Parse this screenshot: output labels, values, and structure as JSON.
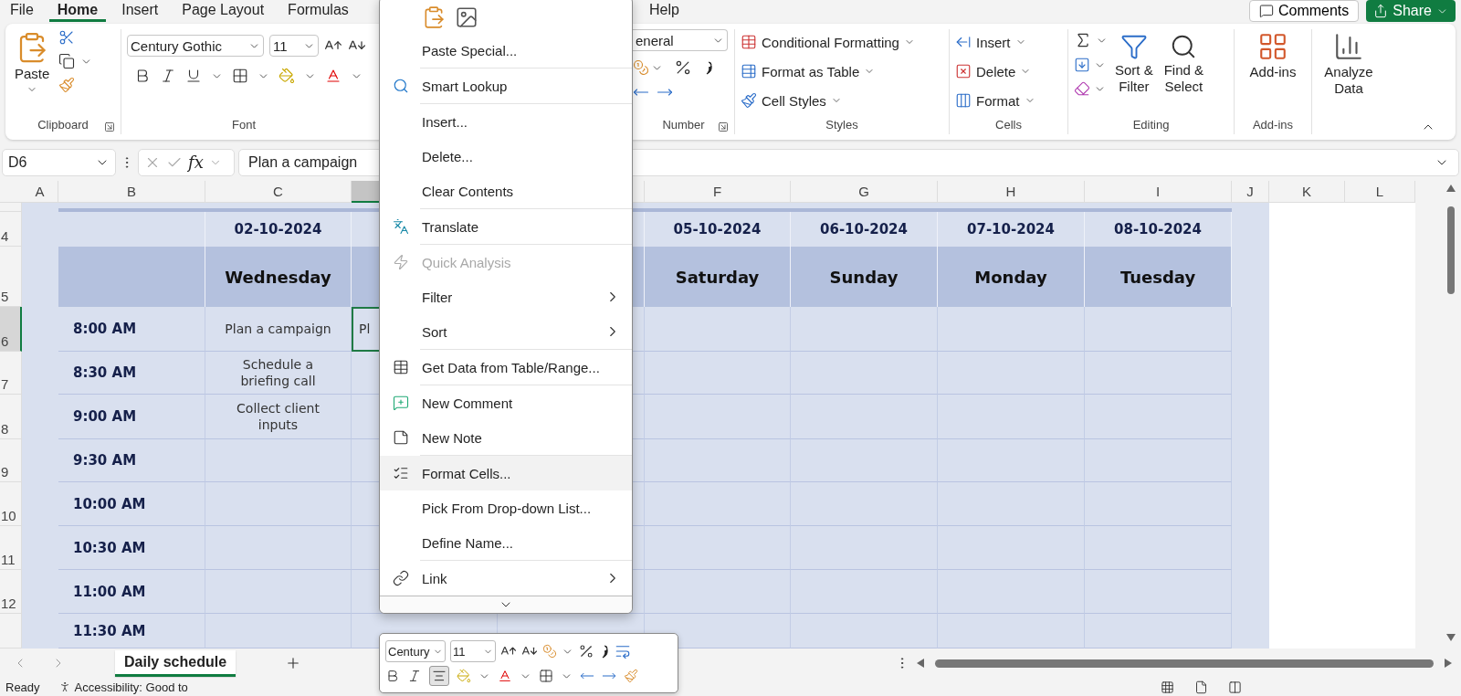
{
  "ribbon_tabs": [
    {
      "label": "File",
      "selected": false
    },
    {
      "label": "Home",
      "selected": true
    },
    {
      "label": "Insert",
      "selected": false
    },
    {
      "label": "Page Layout",
      "selected": false
    },
    {
      "label": "Formulas",
      "selected": false
    },
    {
      "label": "Help",
      "selected": false
    }
  ],
  "top_buttons": {
    "comments": "Comments",
    "share": "Share"
  },
  "ribbon": {
    "clipboard": {
      "paste": "Paste",
      "label": "Clipboard"
    },
    "font": {
      "name": "Century Gothic",
      "size": "11",
      "label": "Font"
    },
    "number": {
      "format": "eneral",
      "label": "Number"
    },
    "styles": {
      "items": [
        "Conditional Formatting",
        "Format as Table",
        "Cell Styles"
      ],
      "label": "Styles"
    },
    "cells": {
      "items": [
        "Insert",
        "Delete",
        "Format"
      ],
      "label": "Cells"
    },
    "editing": {
      "sort_filter": [
        "Sort &",
        "Filter"
      ],
      "find_select": [
        "Find &",
        "Select"
      ],
      "label": "Editing"
    },
    "addins": {
      "button": "Add-ins",
      "label": "Add-ins"
    },
    "analyze": {
      "button": [
        "Analyze",
        "Data"
      ]
    }
  },
  "formula_bar": {
    "name_box": "D6",
    "function_symbol": "fx",
    "formula": "Plan a campaign"
  },
  "sheet": {
    "columns": [
      {
        "label": "A",
        "selected": false
      },
      {
        "label": "B",
        "selected": false
      },
      {
        "label": "C",
        "selected": false
      },
      {
        "selected": true
      },
      {},
      {
        "label": "F",
        "selected": false
      },
      {
        "label": "G",
        "selected": false
      },
      {
        "label": "H",
        "selected": false
      },
      {
        "label": "I",
        "selected": false
      },
      {
        "label": "J",
        "selected": false
      },
      {
        "label": "K",
        "selected": false
      },
      {
        "label": "L",
        "selected": false
      }
    ],
    "rows": [
      {
        "kind": "spacer",
        "selected": false,
        "cells": []
      },
      {
        "number": "4",
        "kind": "date",
        "selected": false,
        "cells": [
          "",
          "",
          "02-10-2024",
          "",
          "",
          "05-10-2024",
          "06-10-2024",
          "07-10-2024",
          "08-10-2024"
        ]
      },
      {
        "number": "5",
        "kind": "day",
        "selected": false,
        "cells": [
          "",
          "",
          "Wednesday",
          "",
          "",
          "Saturday",
          "Sunday",
          "Monday",
          "Tuesday"
        ]
      },
      {
        "number": "6",
        "kind": "slot",
        "selected": true,
        "cells": [
          "",
          "8:00 AM",
          "Plan a campaign",
          "Pl"
        ]
      },
      {
        "number": "7",
        "kind": "slot",
        "selected": false,
        "cells": [
          "",
          "8:30 AM",
          "Schedule a briefing call"
        ]
      },
      {
        "number": "8",
        "kind": "slot",
        "selected": false,
        "cells": [
          "",
          "9:00 AM",
          "Collect client inputs"
        ]
      },
      {
        "number": "9",
        "kind": "slot",
        "selected": false,
        "cells": [
          "",
          "9:30 AM"
        ]
      },
      {
        "number": "10",
        "kind": "slot",
        "selected": false,
        "cells": [
          "",
          "10:00 AM"
        ]
      },
      {
        "number": "11",
        "kind": "slot",
        "selected": false,
        "cells": [
          "",
          "10:30 AM"
        ]
      },
      {
        "number": "12",
        "kind": "slot",
        "selected": false,
        "cells": [
          "",
          "11:00 AM"
        ]
      },
      {
        "kind": "slot",
        "selected": false,
        "cells": [
          "",
          "11:30 AM"
        ]
      }
    ]
  },
  "sheet_tabs": [
    {
      "label": "Daily schedule",
      "selected": true
    }
  ],
  "status_bar": {
    "mode": "Ready",
    "accessibility": "Accessibility: Good to"
  },
  "menu": {
    "groups": [
      {
        "paste_options": true,
        "items": [
          {
            "label": "Paste Special...",
            "disabled": false,
            "highlighted": false
          }
        ]
      },
      {
        "items": [
          {
            "label": "Smart Lookup",
            "kind": "lookup",
            "disabled": false,
            "highlighted": false
          }
        ]
      },
      {
        "items": [
          {
            "label": "Insert...",
            "disabled": false,
            "highlighted": false
          },
          {
            "label": "Delete...",
            "disabled": false,
            "highlighted": false
          },
          {
            "label": "Clear Contents",
            "disabled": false,
            "highlighted": false
          }
        ]
      },
      {
        "items": [
          {
            "label": "Translate",
            "kind": "translate",
            "disabled": false,
            "highlighted": false
          }
        ]
      },
      {
        "items": [
          {
            "label": "Quick Analysis",
            "kind": "analysis",
            "disabled": true,
            "highlighted": false
          },
          {
            "label": "Filter",
            "submenu": true,
            "disabled": false,
            "highlighted": false
          },
          {
            "label": "Sort",
            "submenu": true,
            "disabled": false,
            "highlighted": false
          }
        ]
      },
      {
        "items": [
          {
            "label": "Get Data from Table/Range...",
            "kind": "table",
            "disabled": false,
            "highlighted": false
          }
        ]
      },
      {
        "items": [
          {
            "label": "New Comment",
            "kind": "comment",
            "disabled": false,
            "highlighted": false
          },
          {
            "label": "New Note",
            "kind": "note",
            "disabled": false,
            "highlighted": false
          }
        ]
      },
      {
        "items": [
          {
            "label": "Format Cells...",
            "kind": "format",
            "disabled": false,
            "highlighted": true
          },
          {
            "label": "Pick From Drop-down List...",
            "disabled": false,
            "highlighted": false
          },
          {
            "label": "Define Name...",
            "disabled": false,
            "highlighted": false
          }
        ]
      },
      {
        "items": [
          {
            "label": "Link",
            "kind": "link",
            "submenu": true,
            "disabled": false,
            "highlighted": false
          }
        ]
      }
    ]
  },
  "mini_toolbar": {
    "font": "Century",
    "size": "11",
    "align_center_on": true
  }
}
